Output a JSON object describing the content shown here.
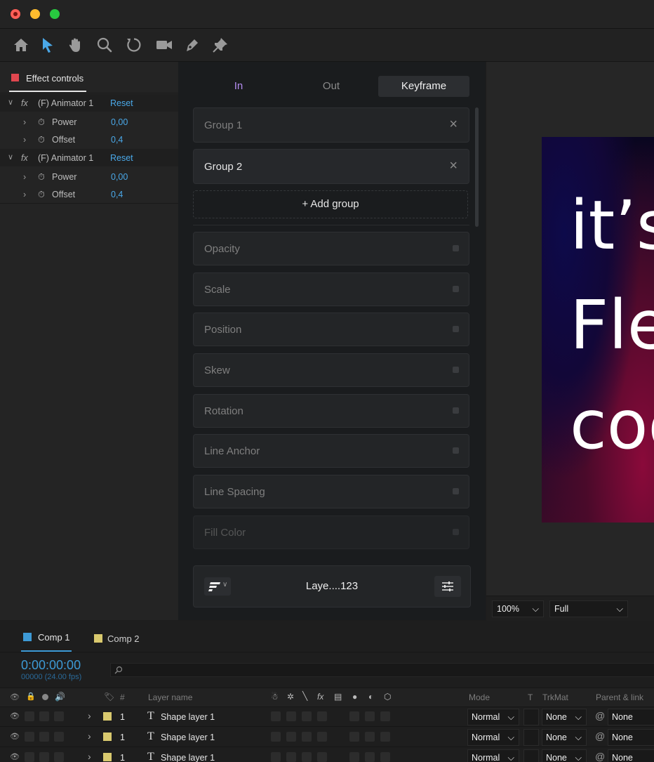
{
  "toolbar": {
    "tools": [
      "home-icon",
      "selection-arrow-icon",
      "hand-icon",
      "zoom-icon",
      "rotate-icon",
      "camera-icon",
      "pen-icon",
      "pin-icon"
    ]
  },
  "effect_controls": {
    "tab_label": "Effect controls",
    "groups": [
      {
        "fx": "fx",
        "name": "(F) Animator 1",
        "reset": "Reset",
        "props": [
          {
            "name": "Power",
            "value": "0,00"
          },
          {
            "name": "Offset",
            "value": "0,4"
          }
        ]
      },
      {
        "fx": "fx",
        "name": "(F) Animator 1",
        "reset": "Reset",
        "props": [
          {
            "name": "Power",
            "value": "0,00"
          },
          {
            "name": "Offset",
            "value": "0,4"
          }
        ]
      }
    ]
  },
  "plugin": {
    "tabs": [
      {
        "label": "In"
      },
      {
        "label": "Out"
      },
      {
        "label": "Keyframe"
      }
    ],
    "groups": [
      {
        "label": "Group 1"
      },
      {
        "label": "Group 2"
      }
    ],
    "add_group": "+ Add group",
    "properties": [
      "Opacity",
      "Scale",
      "Position",
      "Skew",
      "Rotation",
      "Line Anchor",
      "Line Spacing",
      "Fill Color"
    ],
    "footer": {
      "layer_name": "Laye....123"
    }
  },
  "preview": {
    "lines": [
      "it’s",
      "Fle",
      "coo"
    ],
    "zoom": "100%",
    "resolution": "Full"
  },
  "timeline": {
    "comps": [
      {
        "label": "Comp 1",
        "color": "#3d9ad6"
      },
      {
        "label": "Comp 2",
        "color": "#d9c96e"
      }
    ],
    "timecode": "0:00:00:00",
    "fps": "00000 (24.00 fps)",
    "columns": {
      "hash": "#",
      "layer_name": "Layer name",
      "mode": "Mode",
      "t": "T",
      "trkmat": "TrkMat",
      "parent": "Parent & link"
    },
    "layers": [
      {
        "num": "1",
        "name": "Shape layer 1",
        "mode": "Normal",
        "trkmat": "None",
        "parent": "None"
      },
      {
        "num": "1",
        "name": "Shape layer 1",
        "mode": "Normal",
        "trkmat": "None",
        "parent": "None"
      },
      {
        "num": "1",
        "name": "Shape layer 1",
        "mode": "Normal",
        "trkmat": "None",
        "parent": "None"
      }
    ]
  }
}
